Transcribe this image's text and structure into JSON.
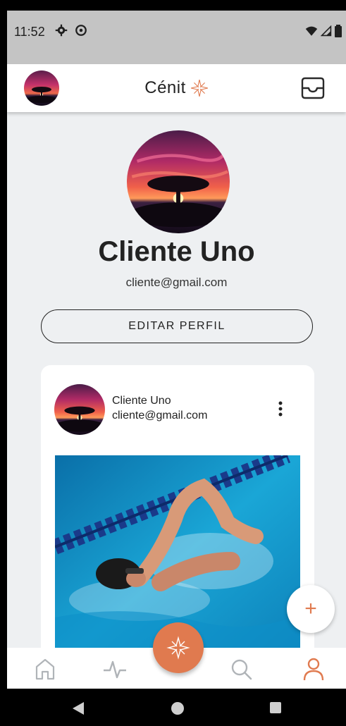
{
  "status": {
    "time": "11:52"
  },
  "appbar": {
    "title": "Cénit"
  },
  "profile": {
    "name": "Cliente Uno",
    "email": "cliente@gmail.com",
    "edit_label": "EDITAR PERFIL"
  },
  "post": {
    "author_name": "Cliente Uno",
    "author_email": "cliente@gmail.com"
  },
  "fab": {
    "add_label": "+"
  },
  "colors": {
    "accent": "#E07A4F",
    "background": "#EEF0F2",
    "nav_inactive": "#B0B4B8"
  },
  "nav": {
    "items": [
      {
        "icon": "home-icon",
        "active": false
      },
      {
        "icon": "activity-icon",
        "active": false
      },
      {
        "icon": "compass-icon",
        "active": false
      },
      {
        "icon": "search-icon",
        "active": false
      },
      {
        "icon": "user-icon",
        "active": true
      }
    ]
  }
}
